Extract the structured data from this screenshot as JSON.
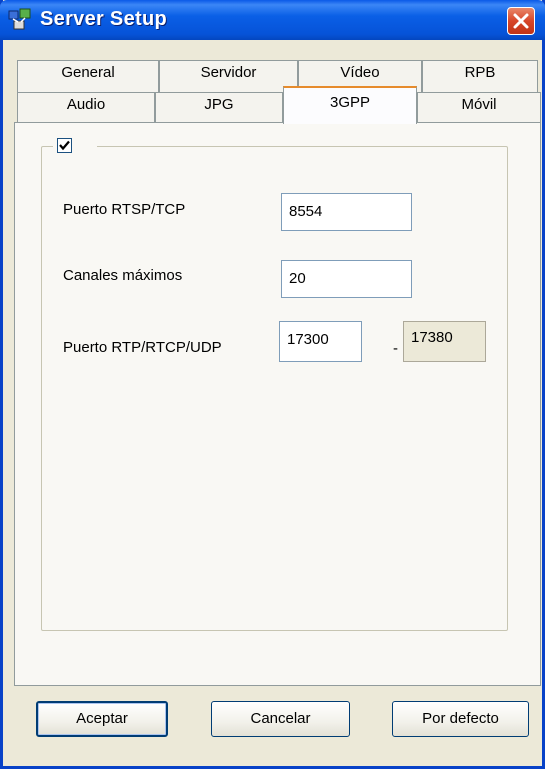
{
  "window": {
    "title": "Server Setup",
    "icon": "network-setup-icon"
  },
  "tabs": {
    "row1": [
      {
        "label": "General"
      },
      {
        "label": "Servidor"
      },
      {
        "label": "Vídeo"
      },
      {
        "label": "RPB"
      }
    ],
    "row2": [
      {
        "label": "Audio"
      },
      {
        "label": "JPG"
      },
      {
        "label": "3GPP",
        "active": true
      },
      {
        "label": "Móvil"
      }
    ]
  },
  "panel": {
    "enabled_checked": true,
    "rtsp_port": {
      "label": "Puerto RTSP/TCP",
      "value": "8554"
    },
    "max_channels": {
      "label": "Canales máximos",
      "value": "20"
    },
    "rtp_port": {
      "label": "Puerto RTP/RTCP/UDP",
      "from": "17300",
      "separator": "-",
      "to": "17380"
    }
  },
  "buttons": {
    "ok": "Aceptar",
    "cancel": "Cancelar",
    "defaults": "Por defecto"
  },
  "colors": {
    "titlebar": "#0a5fe6",
    "face": "#ece9d8",
    "active_tab_accent": "#e68b2c"
  }
}
